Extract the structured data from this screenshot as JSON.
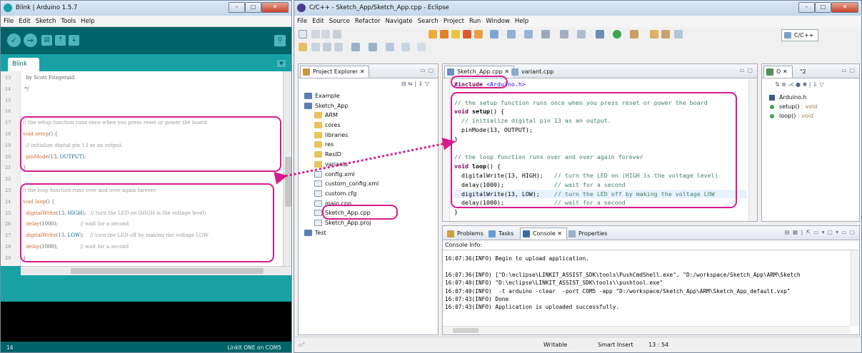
{
  "arduino": {
    "title": "Blink | Arduino 1.5.7",
    "menu": [
      "File",
      "Edit",
      "Sketch",
      "Tools",
      "Help"
    ],
    "tab": "Blink",
    "code_lines": [
      {
        "n": "13",
        "t": "  by Scott Fitzgerald"
      },
      {
        "n": "14",
        "t": " */"
      },
      {
        "n": "15",
        "t": ""
      },
      {
        "n": "16",
        "t": ""
      },
      {
        "n": "17",
        "t": "// the setup function runs once when you press reset or power the board"
      },
      {
        "n": "18",
        "t": "void setup() {"
      },
      {
        "n": "19",
        "t": "  // initialize digital pin 13 as an output."
      },
      {
        "n": "20",
        "t": "  pinMode(13, OUTPUT);"
      },
      {
        "n": "21",
        "t": "}"
      },
      {
        "n": "22",
        "t": ""
      },
      {
        "n": "23",
        "t": "// the loop function runs over and over again forever"
      },
      {
        "n": "24",
        "t": "void loop() {"
      },
      {
        "n": "25",
        "t": "  digitalWrite(13, HIGH);   // turn the LED on (HIGH is the voltage level)"
      },
      {
        "n": "26",
        "t": "  delay(1000);              // wait for a second"
      },
      {
        "n": "27",
        "t": "  digitalWrite(13, LOW);    // turn the LED off by making the voltage LOW"
      },
      {
        "n": "28",
        "t": "  delay(1000);              // wait for a second"
      },
      {
        "n": "29",
        "t": "}"
      }
    ],
    "footer_line": "14",
    "footer_board": "LinkIt ONE on COM5"
  },
  "eclipse": {
    "title": "C/C++ - Sketch_App/Sketch_App.cpp - Eclipse",
    "menu": [
      "File",
      "Edit",
      "Source",
      "Refactor",
      "Navigate",
      "Search",
      "Project",
      "Run",
      "Window",
      "Help"
    ],
    "perspective": "C/C++",
    "project_explorer": {
      "tab": "Project Explorer",
      "tree": [
        {
          "label": "Example",
          "depth": 0,
          "kind": "project"
        },
        {
          "label": "Sketch_App",
          "depth": 0,
          "kind": "project"
        },
        {
          "label": "ARM",
          "depth": 1,
          "kind": "folder"
        },
        {
          "label": "cores",
          "depth": 1,
          "kind": "folder"
        },
        {
          "label": "libraries",
          "depth": 1,
          "kind": "folder"
        },
        {
          "label": "res",
          "depth": 1,
          "kind": "folder"
        },
        {
          "label": "ResID",
          "depth": 1,
          "kind": "folder"
        },
        {
          "label": "variants",
          "depth": 1,
          "kind": "folder"
        },
        {
          "label": "config.xml",
          "depth": 1,
          "kind": "file"
        },
        {
          "label": "custom_config.xml",
          "depth": 1,
          "kind": "file"
        },
        {
          "label": "custom.cfg",
          "depth": 1,
          "kind": "file"
        },
        {
          "label": "main.cpp",
          "depth": 1,
          "kind": "file"
        },
        {
          "label": "Sketch_App.cpp",
          "depth": 1,
          "kind": "file"
        },
        {
          "label": "Sketch_App.proj",
          "depth": 1,
          "kind": "file"
        },
        {
          "label": "Test",
          "depth": 0,
          "kind": "project"
        }
      ]
    },
    "editor": {
      "tabs": [
        "Sketch_App.cpp",
        "variant.cpp"
      ],
      "code_lines": [
        "#include <Arduino.h>",
        "",
        "// the setup function runs once when you press reset or power the board",
        "void setup() {",
        "  // initialize digital pin 13 as an output.",
        "  pinMode(13, OUTPUT);",
        "}",
        "",
        "// the loop function runs over and over again forever",
        "void loop() {",
        "  digitalWrite(13, HIGH);   // turn the LED on (HIGH is the voltage level)",
        "  delay(1000);              // wait for a second",
        "  digitalWrite(13, LOW);    // turn the LED off by making the voltage LOW",
        "  delay(1000);              // wait for a second",
        "}"
      ]
    },
    "outline": {
      "tabs": [
        "O",
        "\"2"
      ],
      "items": [
        {
          "label": "Arduino.h",
          "type": ""
        },
        {
          "label": "setup()",
          "type": " : void"
        },
        {
          "label": "loop()",
          "type": " : void"
        }
      ]
    },
    "bottom": {
      "tabs": [
        "Problems",
        "Tasks",
        "Console",
        "Properties"
      ],
      "console_title": "Console Info:",
      "console_lines": [
        "16:07:36(INFO) Begin to upload application.",
        "",
        "16:07:36(INFO) [\"D:\\eclipse\\LINKIT_ASSIST_SDK\\tools\\PushCmdShell.exe\", \"D:/workspace/Sketch_App\\ARM\\Sketch",
        "16:07:40(INFO) \"D:\\eclipse\\LINKIT_ASSIST_SDK\\tools\\\\pushtool.exe\"",
        "16:07:40(INFO)  -t arduino -clear  -port COM5 -app \"D:/workspace/Sketch_App\\ARM\\Sketch_App_default.vxp\"",
        "16:07:43(INFO) Done",
        "16:07:43(INFO) Application is uploaded successfully."
      ]
    },
    "status": {
      "writable": "Writable",
      "insert": "Smart Insert",
      "position": "13 : 54"
    }
  },
  "colors": {
    "arduino_teal": "#17a1a5",
    "arduino_dark": "#006468",
    "annotation": "#d81b8c"
  }
}
